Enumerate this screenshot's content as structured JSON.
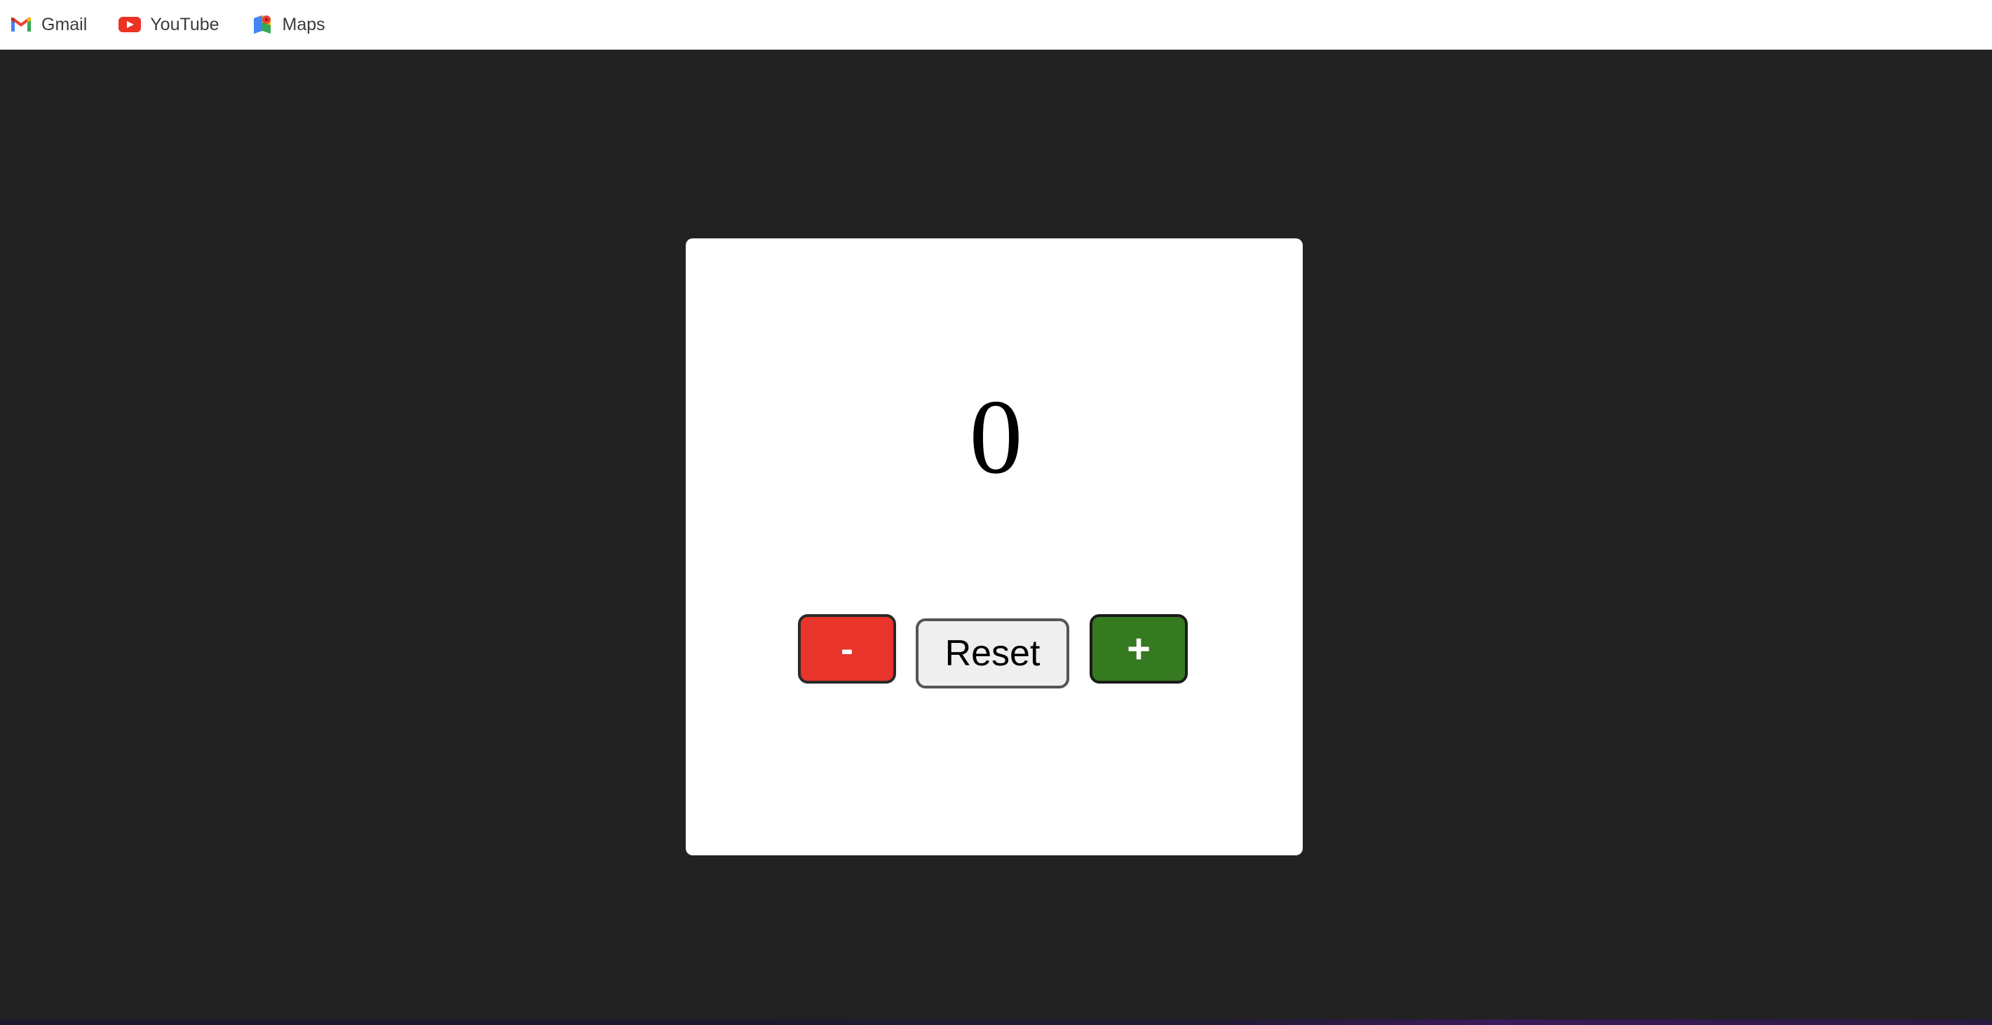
{
  "bookmarks": [
    {
      "label": "Gmail",
      "icon": "gmail-icon"
    },
    {
      "label": "YouTube",
      "icon": "youtube-icon"
    },
    {
      "label": "Maps",
      "icon": "maps-icon"
    }
  ],
  "counter": {
    "value": "0"
  },
  "controls": {
    "decrement_label": "-",
    "reset_label": "Reset",
    "increment_label": "+"
  },
  "colors": {
    "page_background": "#222222",
    "card_background": "#ffffff",
    "decrement_button": "#e8342a",
    "reset_button": "#efefef",
    "increment_button": "#357a21"
  }
}
